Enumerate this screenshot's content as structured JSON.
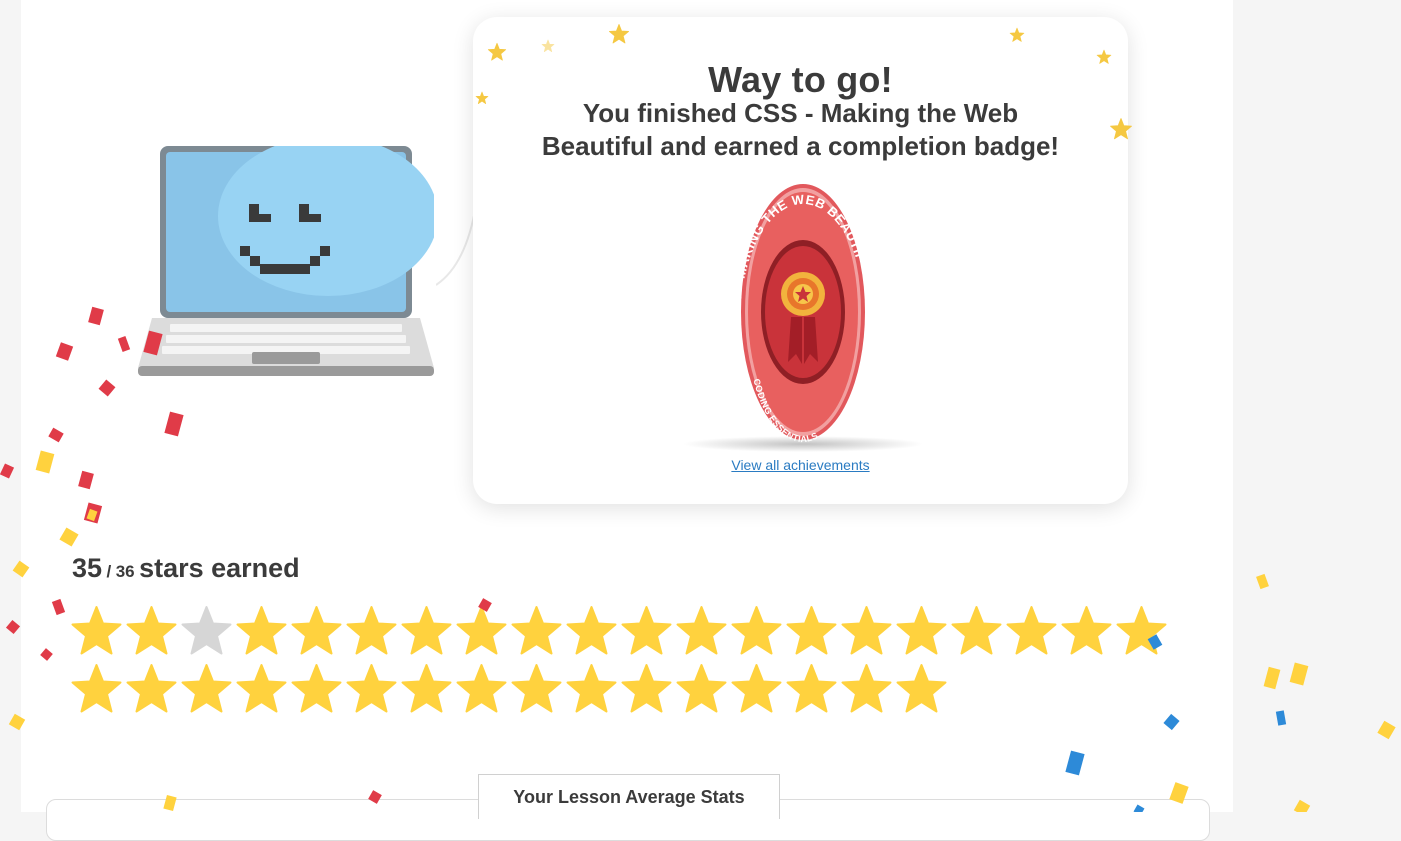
{
  "card": {
    "title": "Way to go!",
    "message": "You finished CSS - Making the Web Beautiful and earned a completion badge!",
    "badge": {
      "ring_text": "SS - MAKING THE WEB BEAUTIF",
      "sub_text": "CODING ESSENTIALS",
      "icon": "medal-icon"
    },
    "achievements_link": "View all achievements"
  },
  "stars": {
    "earned": "35",
    "separator": "/",
    "total": "36",
    "label": "stars earned",
    "row1_count": 20,
    "row2_count": 16,
    "unearned_index": 2
  },
  "stats": {
    "tab_label": "Your Lesson Average Stats"
  },
  "colors": {
    "star_filled": "#ffd23e",
    "star_empty": "#d6d6d6",
    "badge_red": "#e2585c",
    "link_blue": "#2a7bc2"
  }
}
